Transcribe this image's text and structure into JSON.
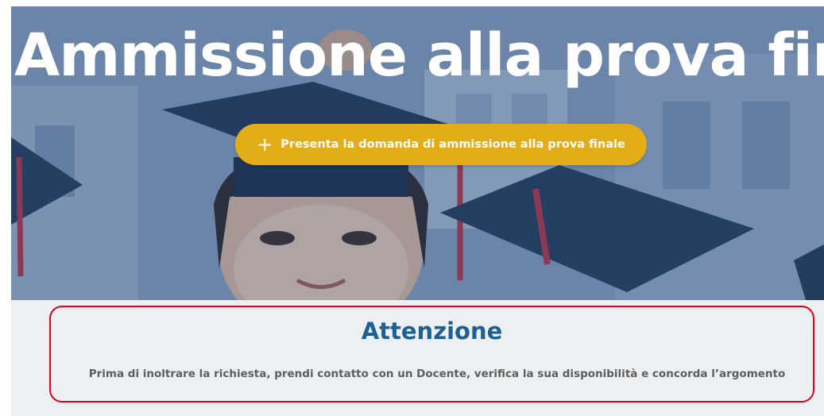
{
  "hero": {
    "title": "Ammissione alla prova finale",
    "cta": {
      "icon": "plus-icon",
      "label": "Presenta la domanda di ammissione alla prova finale"
    }
  },
  "notice": {
    "title": "Attenzione",
    "text": "Prima di inoltrare la richiesta, prendi contatto con un Docente, verifica la sua disponibilità e concorda l’argomento"
  },
  "colors": {
    "cta_background": "#e2ad16",
    "notice_title": "#1f5f94",
    "highlight_border": "#e3001b",
    "notice_background": "#edf0f2"
  }
}
